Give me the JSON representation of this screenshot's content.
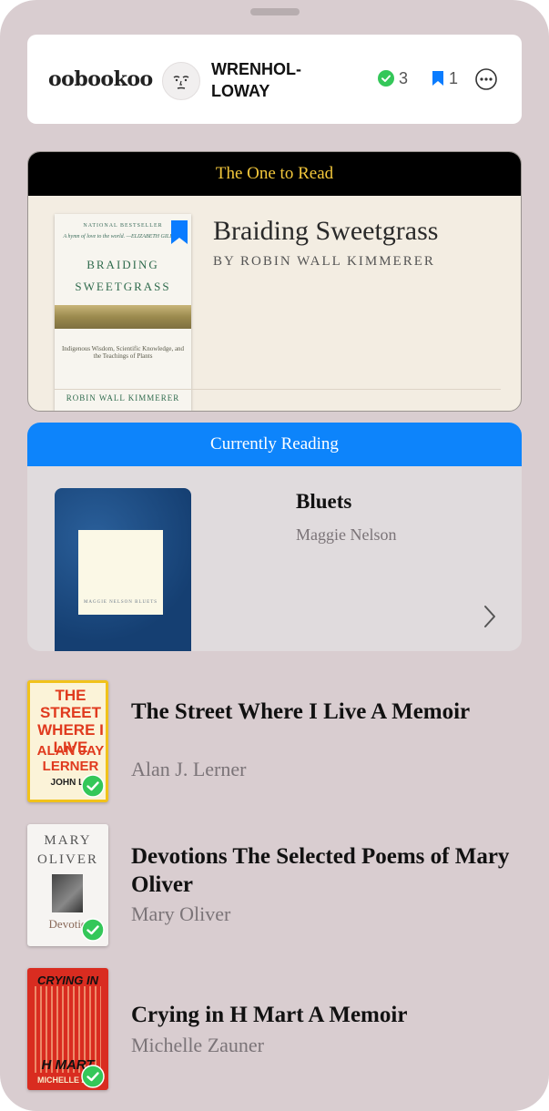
{
  "header": {
    "logo": "oobookoo",
    "username": "WRENHOL-LOWAY",
    "done_count": "3",
    "saved_count": "1"
  },
  "featured": {
    "label": "The One to Read",
    "title": "Braiding Sweetgrass",
    "author": "BY ROBIN WALL KIMMERER",
    "cover": {
      "tag": "NATIONAL BESTSELLER",
      "blurb": "A hymn of love to the world. —ELIZABETH GILBERT",
      "title_line1": "BRAIDING",
      "title_line2": "SWEETGRASS",
      "subtitle": "Indigenous Wisdom, Scientific Knowledge, and the Teachings of Plants",
      "author": "ROBIN WALL KIMMERER"
    }
  },
  "current": {
    "label": "Currently Reading",
    "title": "Bluets",
    "author": "Maggie Nelson",
    "cover_caption": "MAGGIE NELSON   BLUETS"
  },
  "books": [
    {
      "title": "The Street Where I Live A Memoir",
      "author": "Alan J. Lerner",
      "cover_text": "THE STREET WHERE I LIVE",
      "cover_author": "ALAN JAY LERNER",
      "cover_extra": "JOHN LA"
    },
    {
      "title": "Devotions The Selected Poems of Mary Oliver",
      "author": "Mary Oliver",
      "cover_text": "MARY OLIVER",
      "cover_extra": "Devotio"
    },
    {
      "title": "Crying in H Mart A Memoir",
      "author": "Michelle Zauner",
      "cover_text": "CRYING IN",
      "cover_extra": "H MART",
      "cover_author": "MICHELLE ZAU"
    }
  ],
  "colors": {
    "background": "#d9cdd0",
    "featured_bar": "#000000",
    "featured_label": "#f3c73b",
    "current_bar": "#0d84fb",
    "check_green": "#34c759",
    "bookmark_blue": "#0a7cff"
  }
}
